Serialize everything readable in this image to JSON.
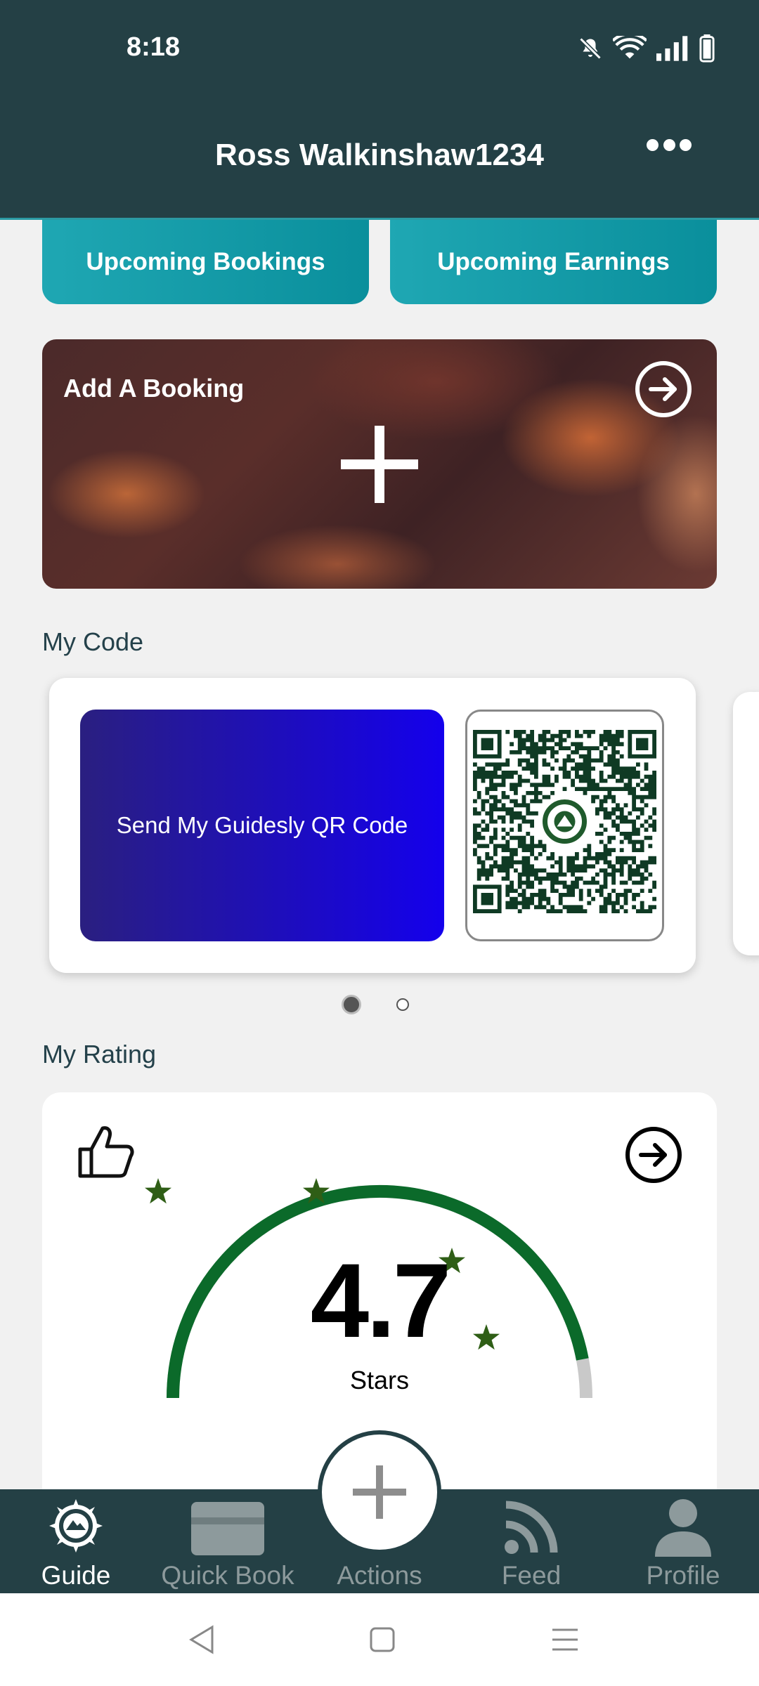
{
  "status_bar": {
    "time": "8:18"
  },
  "header": {
    "title": "Ross Walkinshaw1234"
  },
  "top_buttons": {
    "bookings": "Upcoming Bookings",
    "earnings": "Upcoming Earnings"
  },
  "booking_card": {
    "label": "Add A Booking"
  },
  "my_code": {
    "title": "My Code",
    "send_label": "Send My Guidesly QR Code",
    "page_index": 1,
    "page_count": 2
  },
  "my_rating": {
    "title": "My Rating",
    "value": "4.7",
    "unit": "Stars",
    "fill_fraction": 0.94
  },
  "bottom_nav": {
    "items": [
      {
        "label": "Guide",
        "icon": "compass-mountain-icon",
        "active": true
      },
      {
        "label": "Quick Book",
        "icon": "card-icon",
        "active": false
      },
      {
        "label": "Actions",
        "icon": "plus-icon",
        "active": false
      },
      {
        "label": "Feed",
        "icon": "rss-icon",
        "active": false
      },
      {
        "label": "Profile",
        "icon": "person-icon",
        "active": false
      }
    ]
  },
  "colors": {
    "header": "#244045",
    "teal": "#1fa7b3",
    "gauge_green": "#0b6a2a",
    "star_green": "#2f5e16",
    "qr_button": "#1400ec"
  }
}
